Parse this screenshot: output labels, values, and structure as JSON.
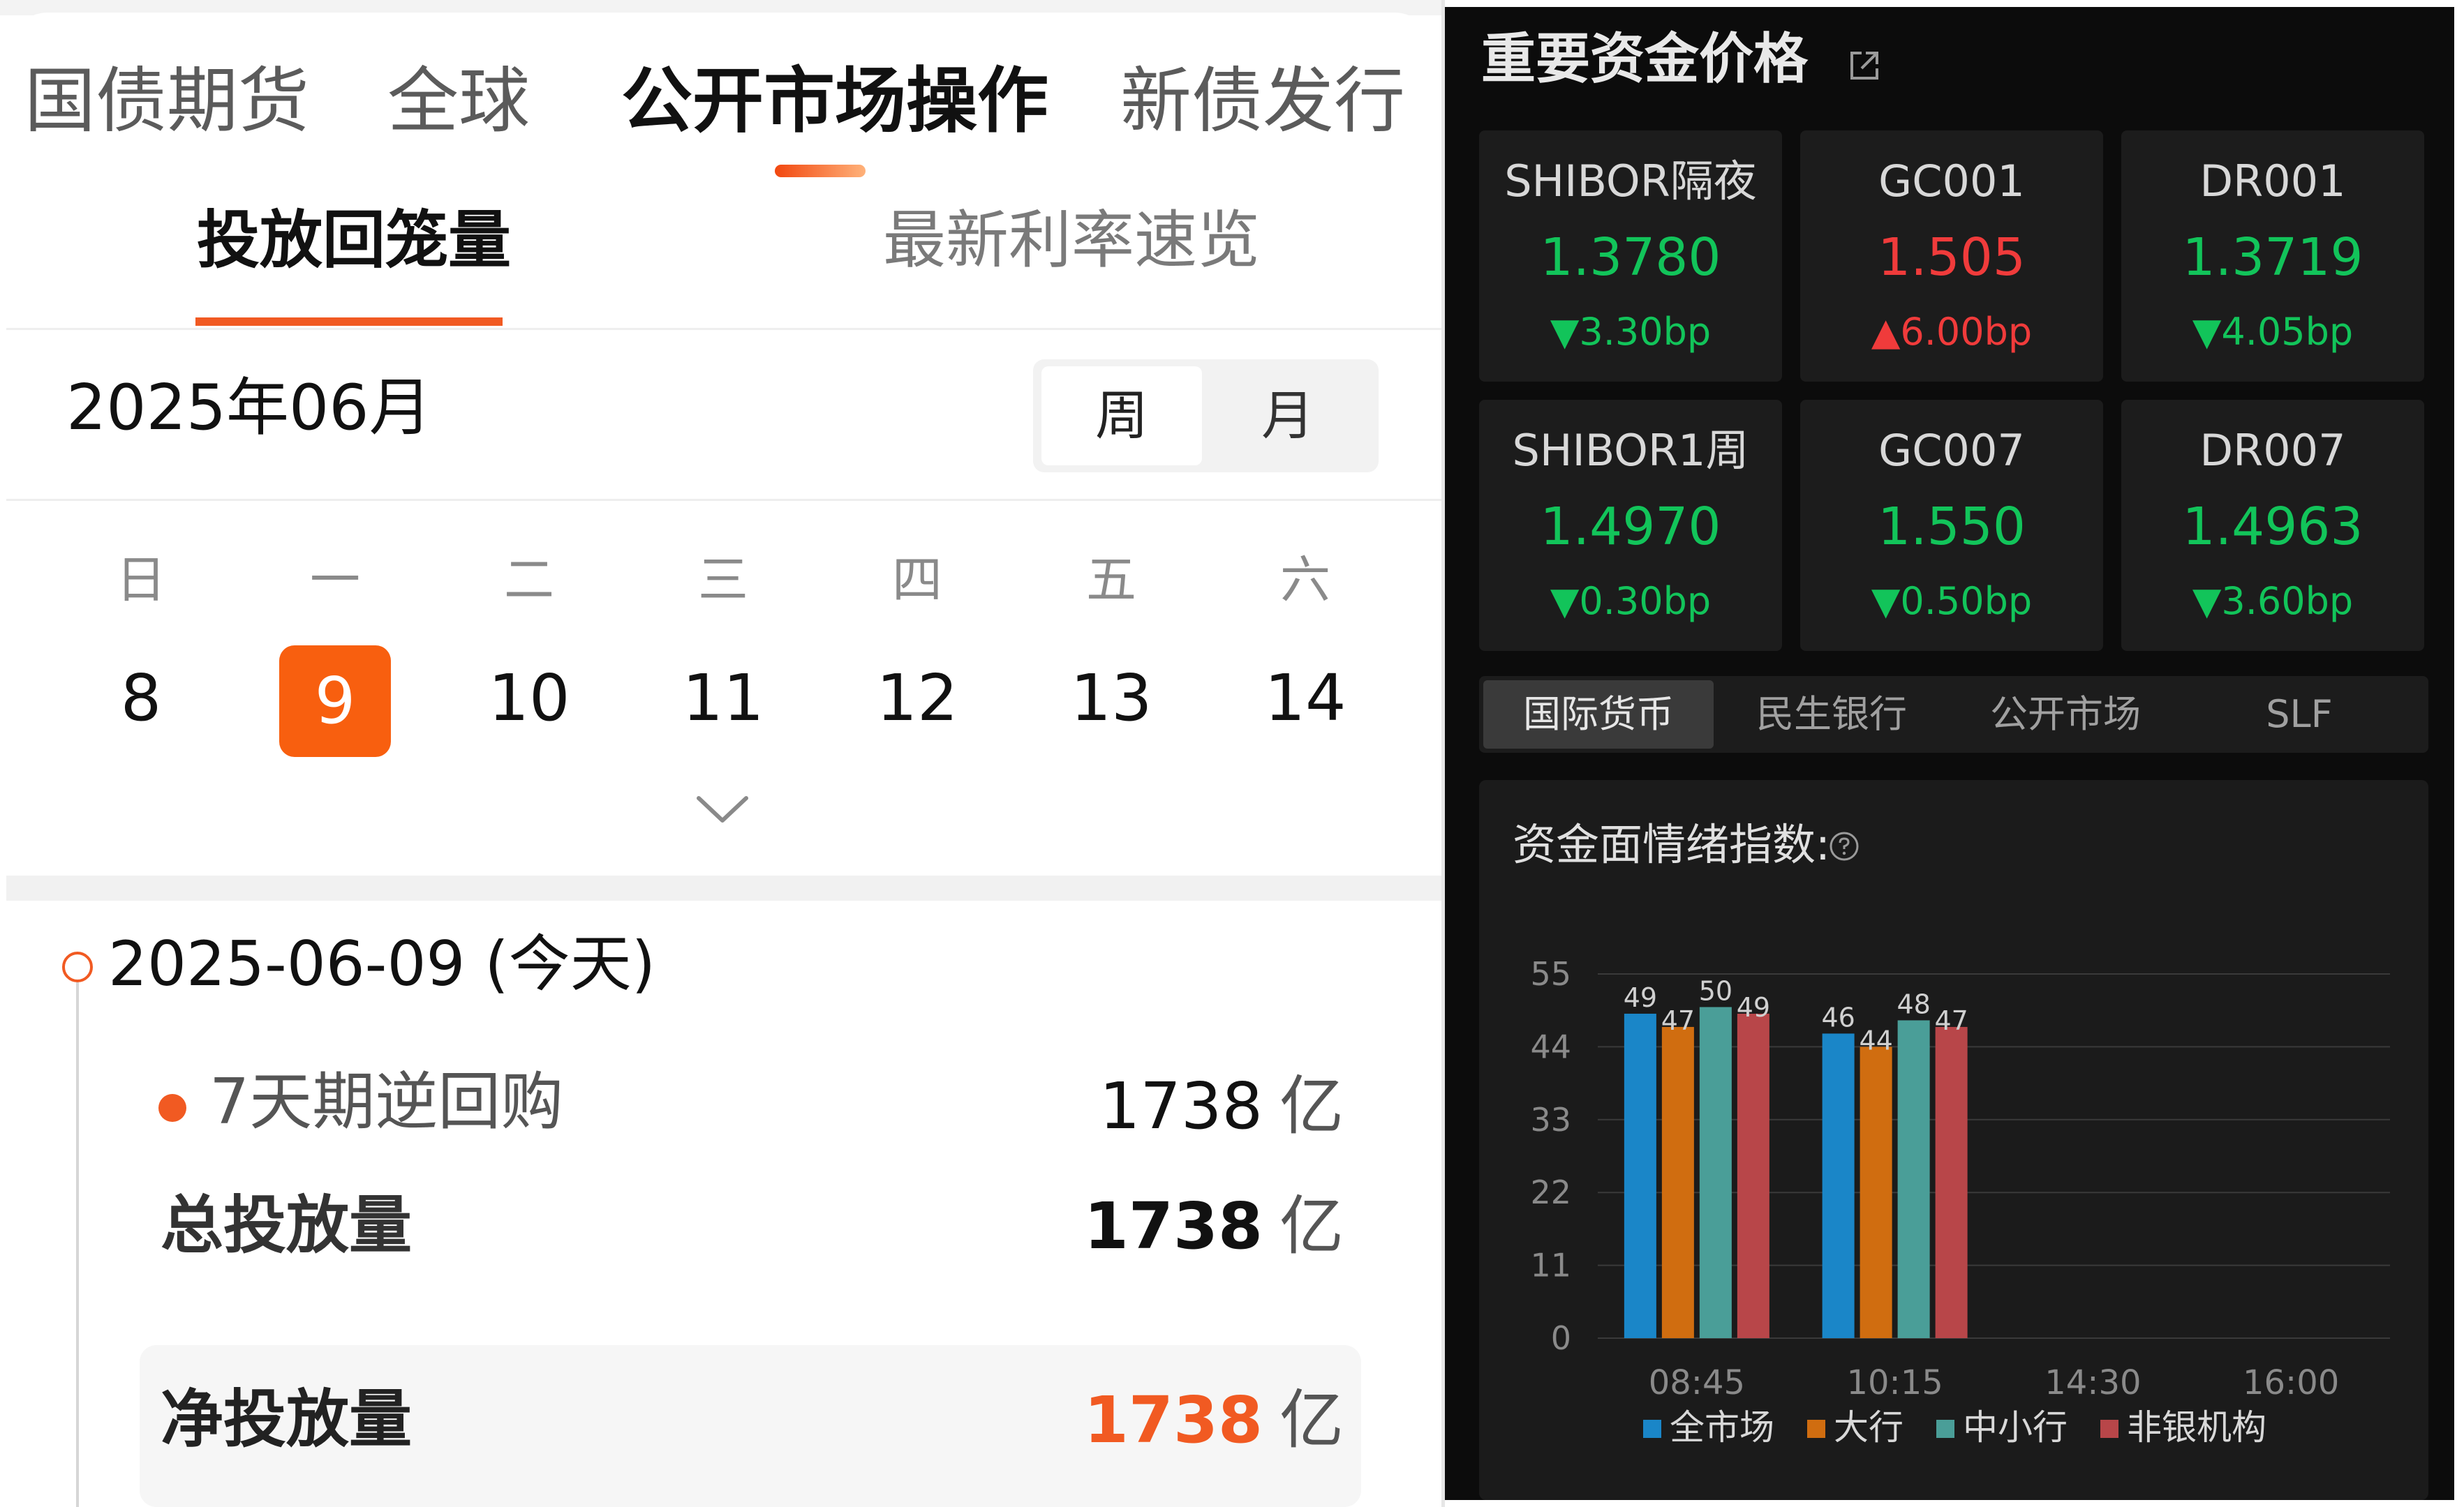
{
  "left": {
    "main_tabs": [
      {
        "label": "国债期货",
        "active": false
      },
      {
        "label": "全球",
        "active": false
      },
      {
        "label": "公开市场操作",
        "active": true
      },
      {
        "label": "新债发行",
        "active": false
      }
    ],
    "sub_tabs": [
      {
        "label": "投放回笼量",
        "active": true
      },
      {
        "label": "最新利率速览",
        "active": false
      }
    ],
    "month_label": "2025年06月",
    "view_toggle": {
      "week": "周",
      "month": "月",
      "selected": "周"
    },
    "week_headers": [
      "日",
      "一",
      "二",
      "三",
      "四",
      "五",
      "六"
    ],
    "week_days": [
      "8",
      "9",
      "10",
      "11",
      "12",
      "13",
      "14"
    ],
    "selected_day": "9",
    "timeline": {
      "date": "2025-06-09 (今天)",
      "rows": [
        {
          "label": "7天期逆回购",
          "value": "1738",
          "unit": "亿"
        },
        {
          "label": "总投放量",
          "value": "1738",
          "unit": "亿"
        },
        {
          "label": "净投放量",
          "value": "1738",
          "unit": "亿"
        }
      ]
    },
    "accent_color": "#f15a22"
  },
  "right": {
    "title": "重要资金价格",
    "share_icon": "share-icon",
    "rates": [
      {
        "name": "SHIBOR隔夜",
        "value": "1.3780",
        "change": "3.30bp",
        "direction": "down"
      },
      {
        "name": "GC001",
        "value": "1.505",
        "change": "6.00bp",
        "direction": "up"
      },
      {
        "name": "DR001",
        "value": "1.3719",
        "change": "4.05bp",
        "direction": "down"
      },
      {
        "name": "SHIBOR1周",
        "value": "1.4970",
        "change": "0.30bp",
        "direction": "down"
      },
      {
        "name": "GC007",
        "value": "1.550",
        "change": "0.50bp",
        "direction": "down"
      },
      {
        "name": "DR007",
        "value": "1.4963",
        "change": "3.60bp",
        "direction": "down"
      }
    ],
    "category_tabs": [
      {
        "label": "国际货币",
        "active": true
      },
      {
        "label": "民生银行",
        "active": false
      },
      {
        "label": "公开市场",
        "active": false
      },
      {
        "label": "SLF",
        "active": false
      }
    ],
    "chart_title": "资金面情绪指数:",
    "colors": {
      "up": "#f03b3b",
      "down": "#12c45a"
    }
  },
  "chart_data": {
    "type": "bar",
    "title": "资金面情绪指数:",
    "categories": [
      "08:45",
      "10:15",
      "14:30",
      "16:00"
    ],
    "series": [
      {
        "name": "全市场",
        "color": "#1a86c8",
        "values": [
          49,
          46,
          null,
          null
        ]
      },
      {
        "name": "大行",
        "color": "#d06d10",
        "values": [
          47,
          44,
          null,
          null
        ]
      },
      {
        "name": "中小行",
        "color": "#4a9e98",
        "values": [
          50,
          48,
          null,
          null
        ]
      },
      {
        "name": "非银机构",
        "color": "#b84649",
        "values": [
          49,
          47,
          null,
          null
        ]
      }
    ],
    "y_ticks": [
      0,
      11,
      22,
      33,
      44,
      55
    ],
    "ylim": [
      0,
      55
    ],
    "grid": true,
    "legend_position": "bottom"
  }
}
